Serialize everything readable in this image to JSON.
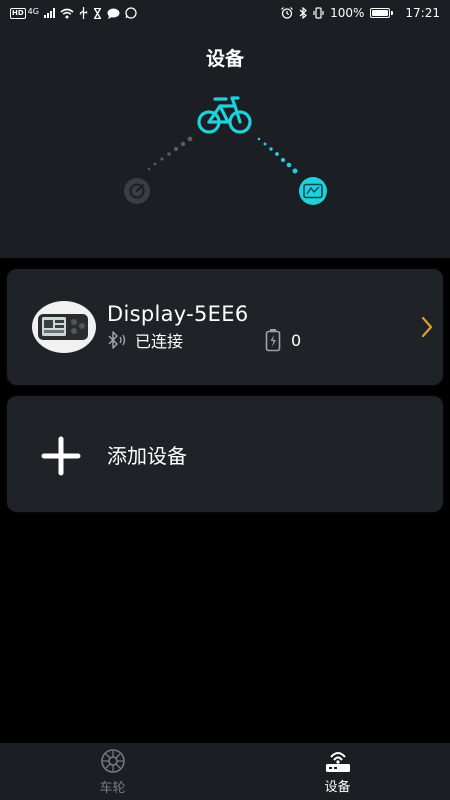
{
  "status_bar": {
    "network_badge": "HD",
    "network_type": "4G",
    "battery_percent": "100%",
    "time": "17:21",
    "icons": [
      "hd-icon",
      "signal-icon",
      "wifi-icon",
      "usb-icon",
      "hourglass-icon",
      "message-icon",
      "whatsapp-icon",
      "alarm-icon",
      "bluetooth-icon",
      "vibrate-icon",
      "battery-icon"
    ]
  },
  "header": {
    "title": "设备",
    "icons": [
      "bicycle-icon",
      "speedometer-icon",
      "display-icon"
    ],
    "colors": {
      "accent": "#1fd0dd",
      "dim": "#4a4e54"
    }
  },
  "device": {
    "name": "Display-5EE6",
    "connection_status": "已连接",
    "battery_value": "0",
    "icons": [
      "display-device-thumbnail",
      "bluetooth-icon",
      "battery-icon",
      "chevron-right-icon"
    ]
  },
  "add_device": {
    "label": "添加设备",
    "icon": "plus-icon"
  },
  "bottom_nav": {
    "items": [
      {
        "label": "车轮",
        "icon": "wheel-icon",
        "active": false
      },
      {
        "label": "设备",
        "icon": "device-icon",
        "active": true
      }
    ]
  },
  "colors": {
    "background": "#000000",
    "surface": "#1b1e22",
    "card": "#1f2226",
    "accent": "#1fd0dd",
    "chevron": "#e0a030",
    "inactive": "#777a7e"
  }
}
